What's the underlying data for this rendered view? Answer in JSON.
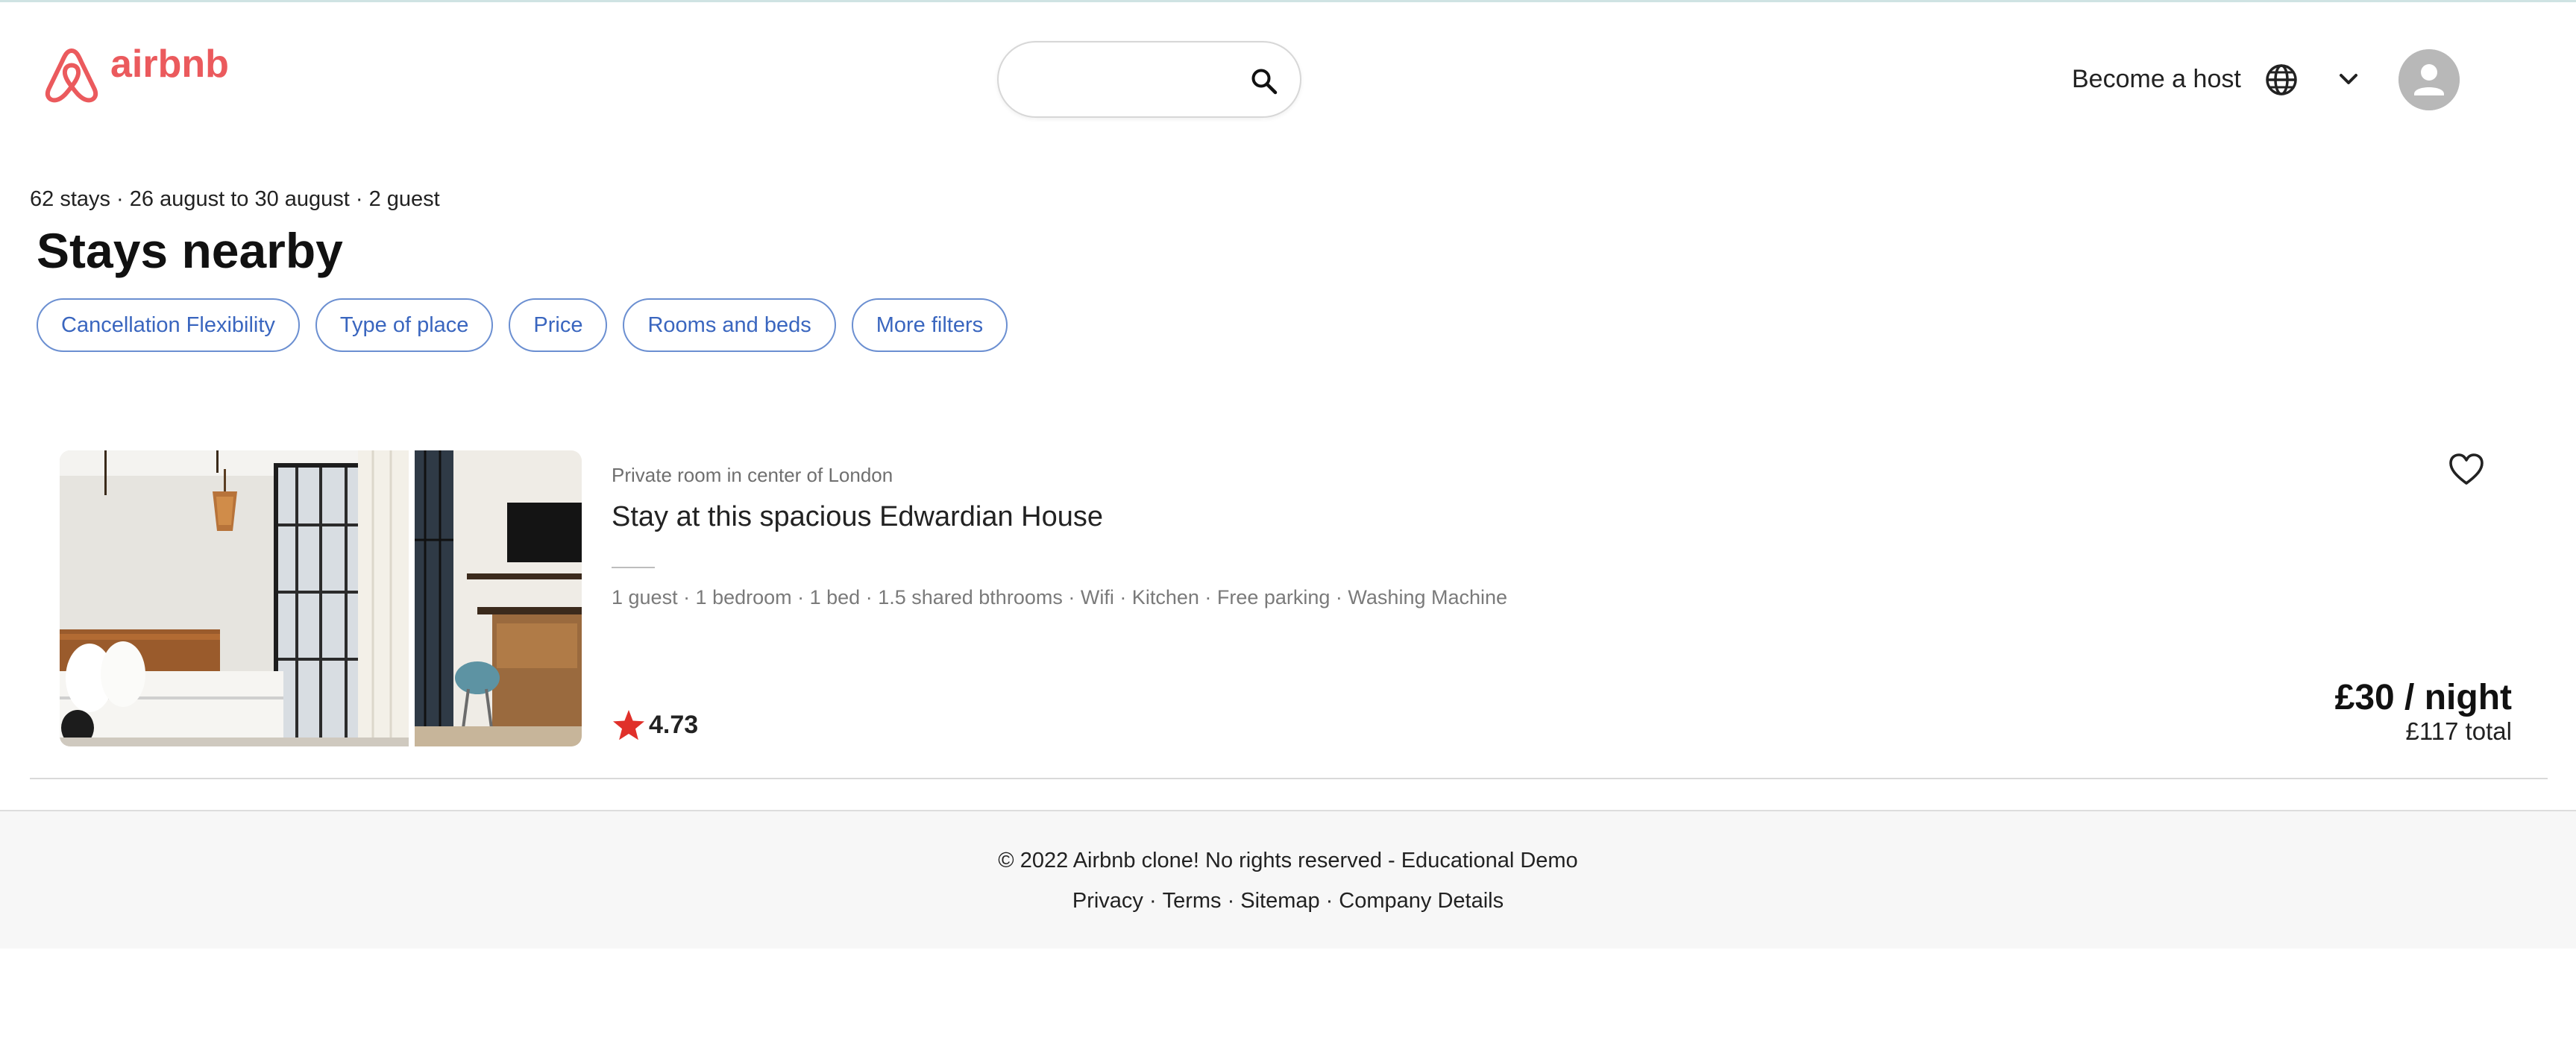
{
  "header": {
    "logo_text": "airbnb",
    "search": {
      "value": "",
      "placeholder": "",
      "button_icon": "search-icon"
    },
    "become_host_label": "Become a host",
    "language_icon": "globe-icon",
    "menu_icon": "chevron-down-icon",
    "avatar_icon": "user-avatar-icon"
  },
  "results": {
    "meta": "62 stays · 26 august to 30 august · 2 guest",
    "title": "Stays nearby",
    "filters": [
      {
        "label": "Cancellation Flexibility"
      },
      {
        "label": "Type of place"
      },
      {
        "label": "Price"
      },
      {
        "label": "Rooms and beds"
      },
      {
        "label": "More filters"
      }
    ]
  },
  "listing": {
    "subtitle": "Private room in center of London",
    "title": "Stay at this spacious Edwardian House",
    "amenities": "1 guest · 1 bedroom · 1 bed · 1.5 shared bthrooms · Wifi · Kitchen · Free parking · Washing Machine",
    "rating": "4.73",
    "price_night": "£30 / night",
    "price_total": "£117 total",
    "favorite_icon": "heart-icon",
    "rating_icon": "star-icon"
  },
  "footer": {
    "copyright": "© 2022 Airbnb clone! No rights reserved - Educational Demo",
    "links": [
      {
        "label": "Privacy"
      },
      {
        "label": "Terms"
      },
      {
        "label": "Sitemap"
      },
      {
        "label": "Company Details"
      }
    ],
    "separator": "·"
  },
  "colors": {
    "brand": "#eb5a5d",
    "filter_text": "#3a66bf",
    "filter_border": "#6b8fd1",
    "star": "#e0302a",
    "footer_bg": "#f7f7f7"
  }
}
